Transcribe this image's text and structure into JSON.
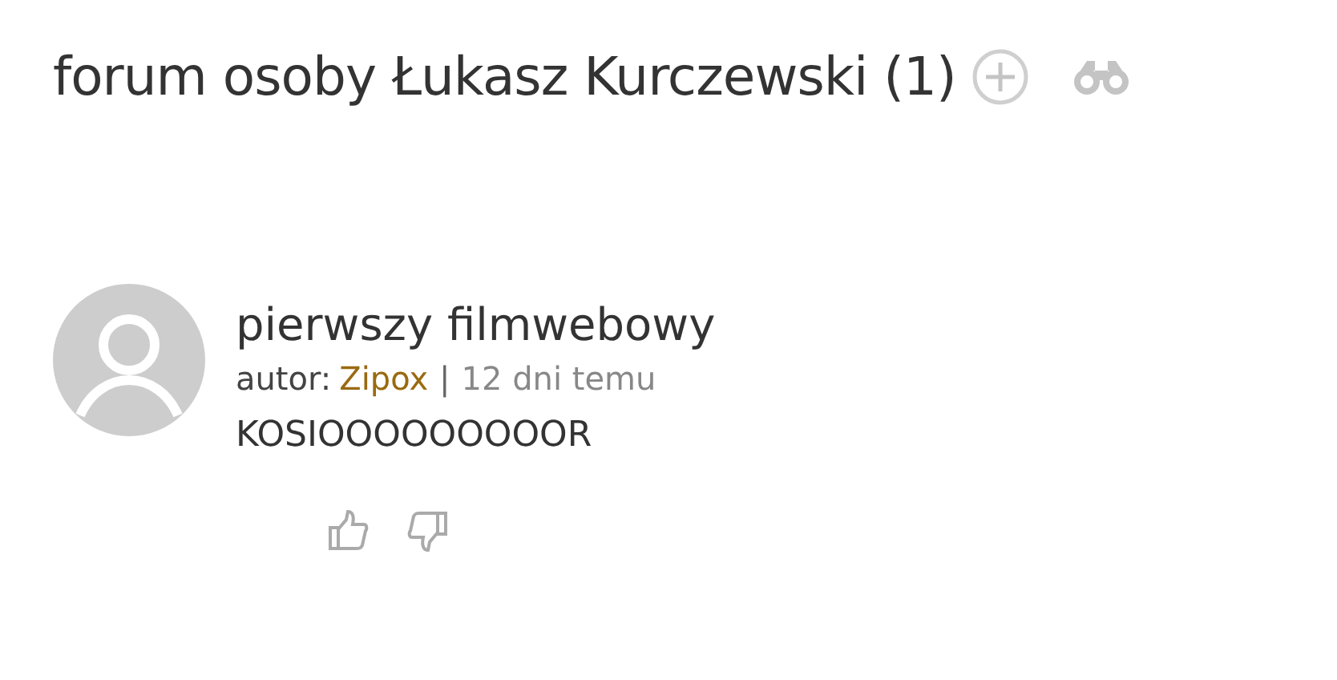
{
  "header": {
    "title": "forum osoby Łukasz Kurczewski (1)"
  },
  "posts": [
    {
      "title": "pierwszy filmwebowy",
      "author_label": "autor:",
      "author": "Zipox",
      "separator": "|",
      "time": "12 dni temu",
      "body": "KOSIOOOOOOOOOR"
    }
  ]
}
